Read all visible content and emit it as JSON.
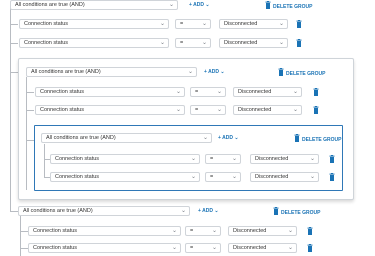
{
  "group_mode_label": "All conditions are true (AND)",
  "add_label": "ADD",
  "delete_group_label": "DELETE GROUP",
  "condition": {
    "field": "Connection status",
    "operator": "=",
    "value": "Disconnected"
  },
  "colors": {
    "accent": "#1a73b5",
    "nested_border": "#2f78b7",
    "connector": "#b8bcc2"
  },
  "icons": {
    "trash": "trash-icon",
    "chevron": "chevron-down-icon",
    "plus": "plus-icon"
  }
}
